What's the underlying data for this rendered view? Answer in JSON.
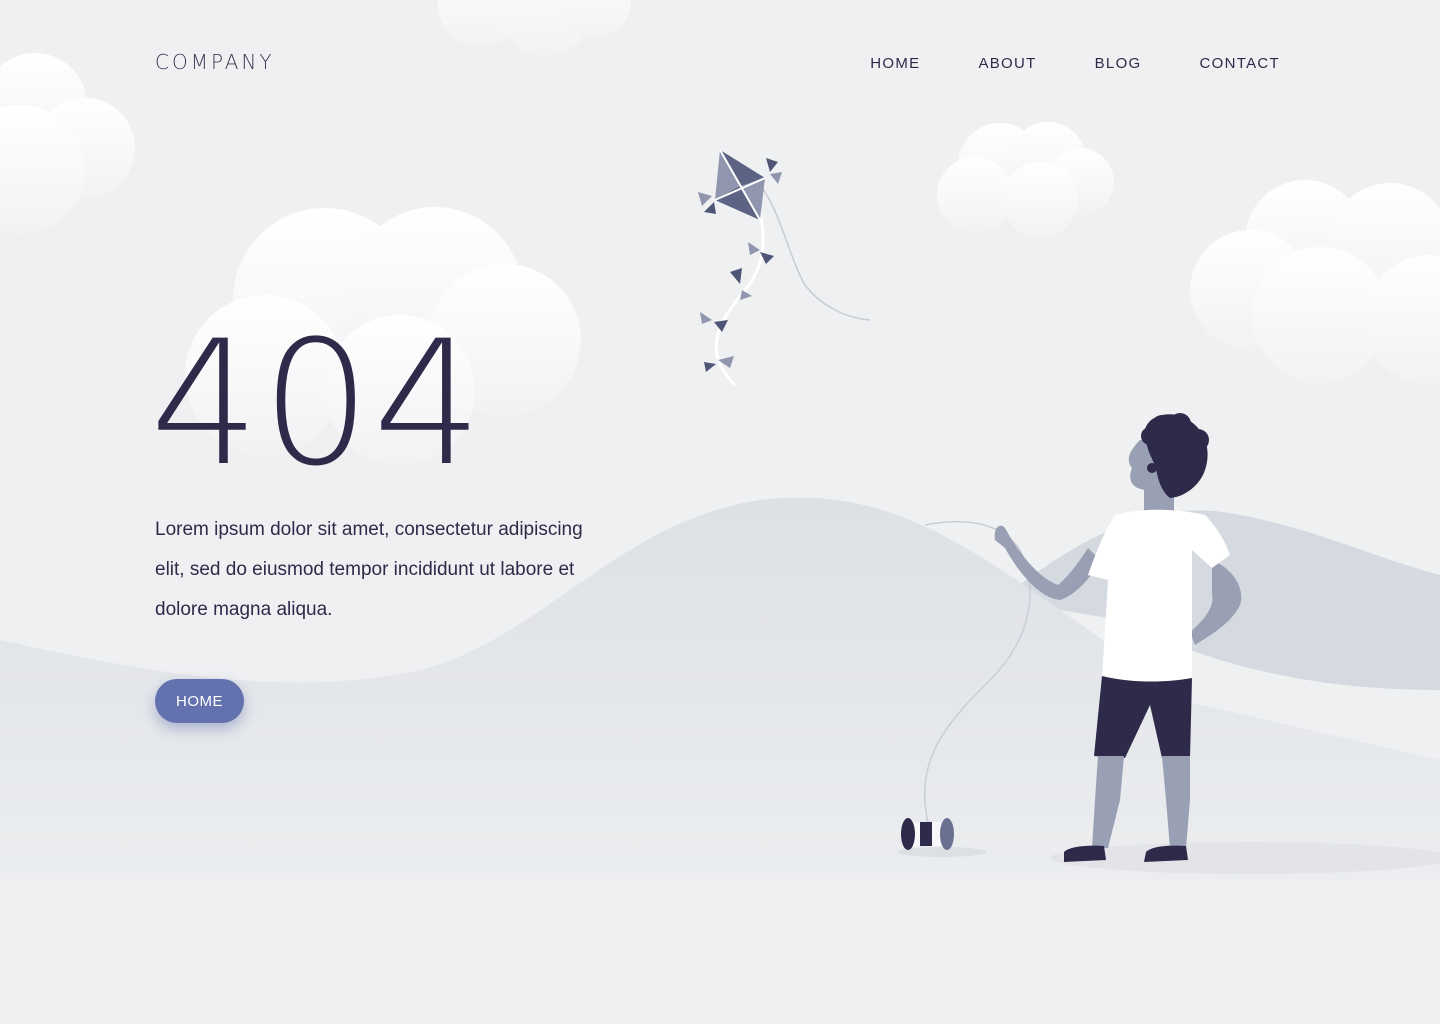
{
  "header": {
    "logo": "COMPANY",
    "nav": [
      {
        "label": "HOME"
      },
      {
        "label": "ABOUT"
      },
      {
        "label": "BLOG"
      },
      {
        "label": "CONTACT"
      }
    ]
  },
  "main": {
    "error_code": "404",
    "description": "Lorem ipsum dolor sit amet, consectetur adipiscing elit, sed do eiusmod tempor incididunt ut labore et dolore magna aliqua.",
    "home_button": "HOME"
  },
  "illustration": {
    "subject": "boy-flying-kite",
    "icons": [
      "cloud-icon",
      "kite-icon",
      "spool-icon"
    ]
  },
  "colors": {
    "background": "#eff0f2",
    "text_dark": "#2e2a49",
    "accent": "#6372ae",
    "hill": "#dfe2e7"
  }
}
